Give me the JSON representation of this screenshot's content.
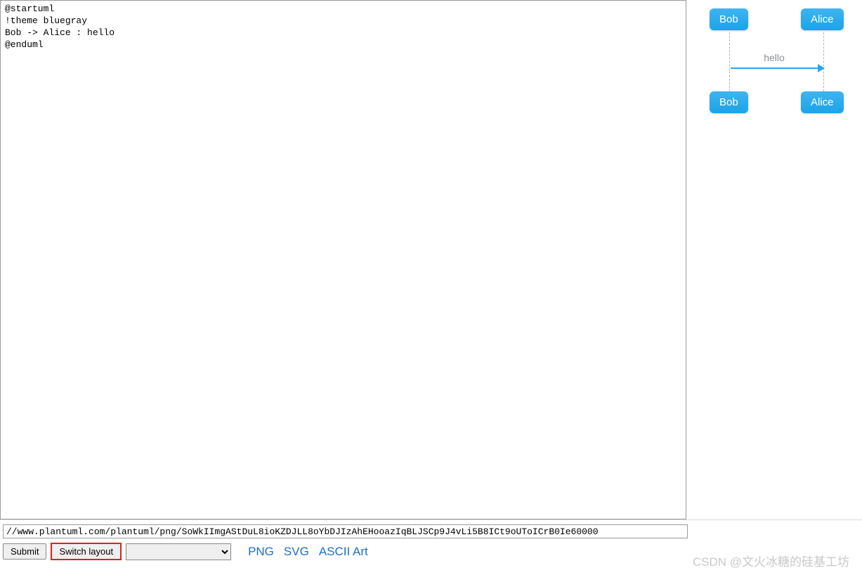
{
  "editor": {
    "lines": "@startuml\n!theme bluegray\nBob -> Alice : hello\n@enduml"
  },
  "diagram": {
    "participants": {
      "bob": "Bob",
      "alice": "Alice"
    },
    "message": "hello"
  },
  "url_bar": {
    "value": "//www.plantuml.com/plantuml/png/SoWkIImgAStDuL8ioKZDJLL8oYbDJIzAhEHooazIqBLJSCp9J4vLi5B8ICt9oUToICrB0Ie60000"
  },
  "controls": {
    "submit": "Submit",
    "switch_layout": "Switch layout"
  },
  "formats": {
    "png": "PNG",
    "svg": "SVG",
    "ascii": "ASCII Art"
  },
  "watermark": "CSDN @文火冰糖的硅基工坊"
}
